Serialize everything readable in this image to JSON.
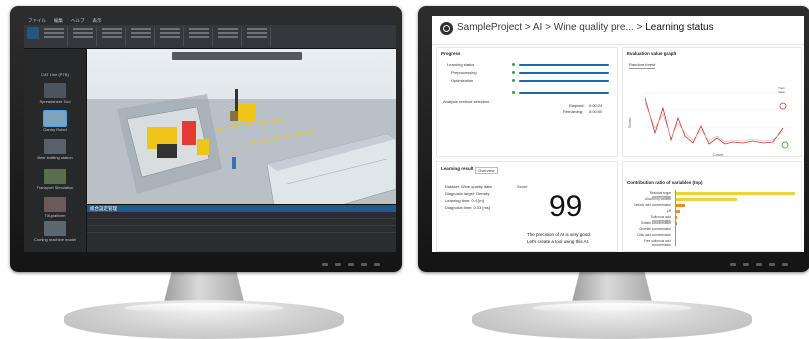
{
  "left_app": {
    "menu": [
      "ファイル",
      "編集",
      "ヘルプ",
      "表示"
    ],
    "library_items": [
      {
        "label": "CAT Line (PTB)"
      },
      {
        "label": "Spreadsheet Tool"
      },
      {
        "label": "Gantry Robot"
      },
      {
        "label": "Beer bottling station"
      },
      {
        "label": "Transport Simulation"
      },
      {
        "label": "Tilt-platform"
      },
      {
        "label": "Coming machine model"
      }
    ],
    "bottom_panel_title": "総合設定管理"
  },
  "dashboard": {
    "breadcrumb": {
      "project": "SampleProject",
      "sep1": ">",
      "section": "AI",
      "sep2": ">",
      "model": "Wine quality pre...",
      "sep3": ">",
      "page": "Learning status"
    },
    "progress": {
      "title": "Progress",
      "items": [
        {
          "label": "Learning status",
          "fill": 1.0
        },
        {
          "label": "Preprocessing",
          "fill": 1.0
        },
        {
          "label": "Optimization",
          "fill": 1.0
        },
        {
          "label": "",
          "fill": 1.0
        }
      ],
      "analysis_label": "Analysis method selection",
      "elapsed_label": "Elapsed:",
      "elapsed_value": "0:00:24",
      "remaining_label": "Remaining:",
      "remaining_value": "0:00:00"
    },
    "eval_graph": {
      "title": "Evaluation value graph",
      "algorithm": "Random forest",
      "xlabel": "Count",
      "ylabel": "Score",
      "legend": [
        "Train",
        "Valid"
      ],
      "colors": {
        "train": "#e0777c",
        "valid": "#c0392b"
      }
    },
    "result": {
      "title": "Learning result",
      "display_label": "Overview",
      "dataset": "Dataset: Wine quality data",
      "target": "Diagnosis target: Density",
      "time": "Learning time: 0.4 [m]",
      "diag_time": "Diagnosis time: 0.03 [ms]",
      "score_label": "Score",
      "score": "99",
      "message_line1": "The precision of AI is very good.",
      "message_line2": "Let's create a tool using this AI."
    },
    "contribution": {
      "title": "Contribution ratio of variables (top)",
      "ylabel": "Variables",
      "bars": [
        {
          "label": "Residual sugar concentration",
          "value": 1.0,
          "color": "#f2d230"
        },
        {
          "label": "Alcohol by volume",
          "value": 0.52,
          "color": "#f2d230"
        },
        {
          "label": "Tartaric acid concentration",
          "value": 0.08,
          "color": "#f08a24"
        },
        {
          "label": "pH",
          "value": 0.04,
          "color": "#f08a24"
        },
        {
          "label": "Sulfurous acid concentration",
          "value": 0.02,
          "color": "#f08a24"
        },
        {
          "label": "Sulfate concentration",
          "value": 0.015,
          "color": "#f08a24"
        },
        {
          "label": "Chloride concentration",
          "value": 0.01,
          "color": "#f08a24"
        },
        {
          "label": "Citric acid concentration",
          "value": 0.008,
          "color": "#f08a24"
        },
        {
          "label": "Free sulfurous acid concentration",
          "value": 0.005,
          "color": "#f08a24"
        }
      ]
    }
  }
}
